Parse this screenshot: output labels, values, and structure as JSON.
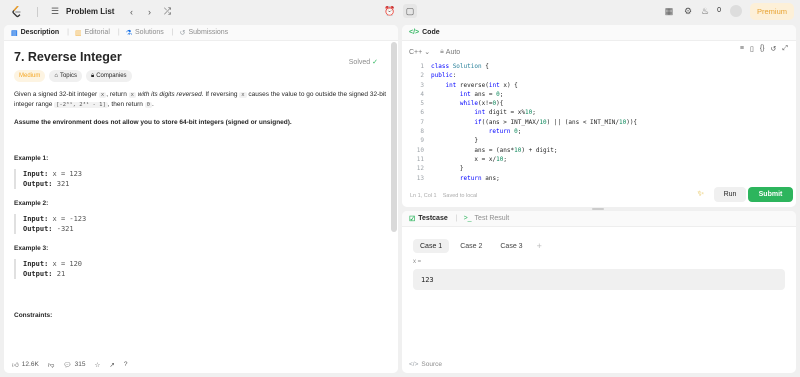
{
  "topbar": {
    "problem_list_label": "Problem List",
    "streak_count": "0",
    "premium_label": "Premium"
  },
  "left_tabs": [
    {
      "label": "Description"
    },
    {
      "label": "Editorial"
    },
    {
      "label": "Solutions"
    },
    {
      "label": "Submissions"
    }
  ],
  "problem": {
    "title": "7. Reverse Integer",
    "status": "Solved",
    "difficulty": "Medium",
    "topics_label": "Topics",
    "companies_label": "Companies",
    "desc_1a": "Given a signed 32-bit integer",
    "desc_1b": ", return",
    "desc_1c": "with its digits reversed",
    "desc_1d": ". If reversing",
    "desc_1e": "causes the value to go outside the signed 32-bit integer range",
    "desc_range": "[-2³¹, 2³¹ - 1]",
    "desc_1f": ", then return",
    "var_x": "x",
    "zero": "0",
    "assume": "Assume the environment does not allow you to store 64-bit integers (signed or unsigned).",
    "constraints_title": "Constraints:"
  },
  "examples": [
    {
      "title": "Example 1:",
      "input_label": "Input:",
      "input": "x = 123",
      "output_label": "Output:",
      "output": "321"
    },
    {
      "title": "Example 2:",
      "input_label": "Input:",
      "input": "x = -123",
      "output_label": "Output:",
      "output": "-321"
    },
    {
      "title": "Example 3:",
      "input_label": "Input:",
      "input": "x = 120",
      "output_label": "Output:",
      "output": "21"
    }
  ],
  "footer": {
    "likes": "12.6K",
    "comments": "315"
  },
  "code_panel": {
    "title": "Code",
    "language": "C++",
    "mode": "Auto",
    "status_position": "Ln 1, Col 1",
    "status_saved": "Saved to local",
    "run_label": "Run",
    "submit_label": "Submit"
  },
  "code_lines": [
    "class Solution {",
    "public:",
    "    int reverse(int x) {",
    "        int ans = 0;",
    "        while(x!=0){",
    "            int digit = x%10;",
    "            if((ans > INT_MAX/10) || (ans < INT_MIN/10)){",
    "                return 0;",
    "            }",
    "            ans = (ans*10) + digit;",
    "            x = x/10;",
    "        }",
    "        return ans;"
  ],
  "test_panel": {
    "testcase_label": "Testcase",
    "result_label": "Test Result",
    "cases": [
      "Case 1",
      "Case 2",
      "Case 3"
    ],
    "var_label": "x =",
    "value": "123",
    "source_label": "Source"
  }
}
